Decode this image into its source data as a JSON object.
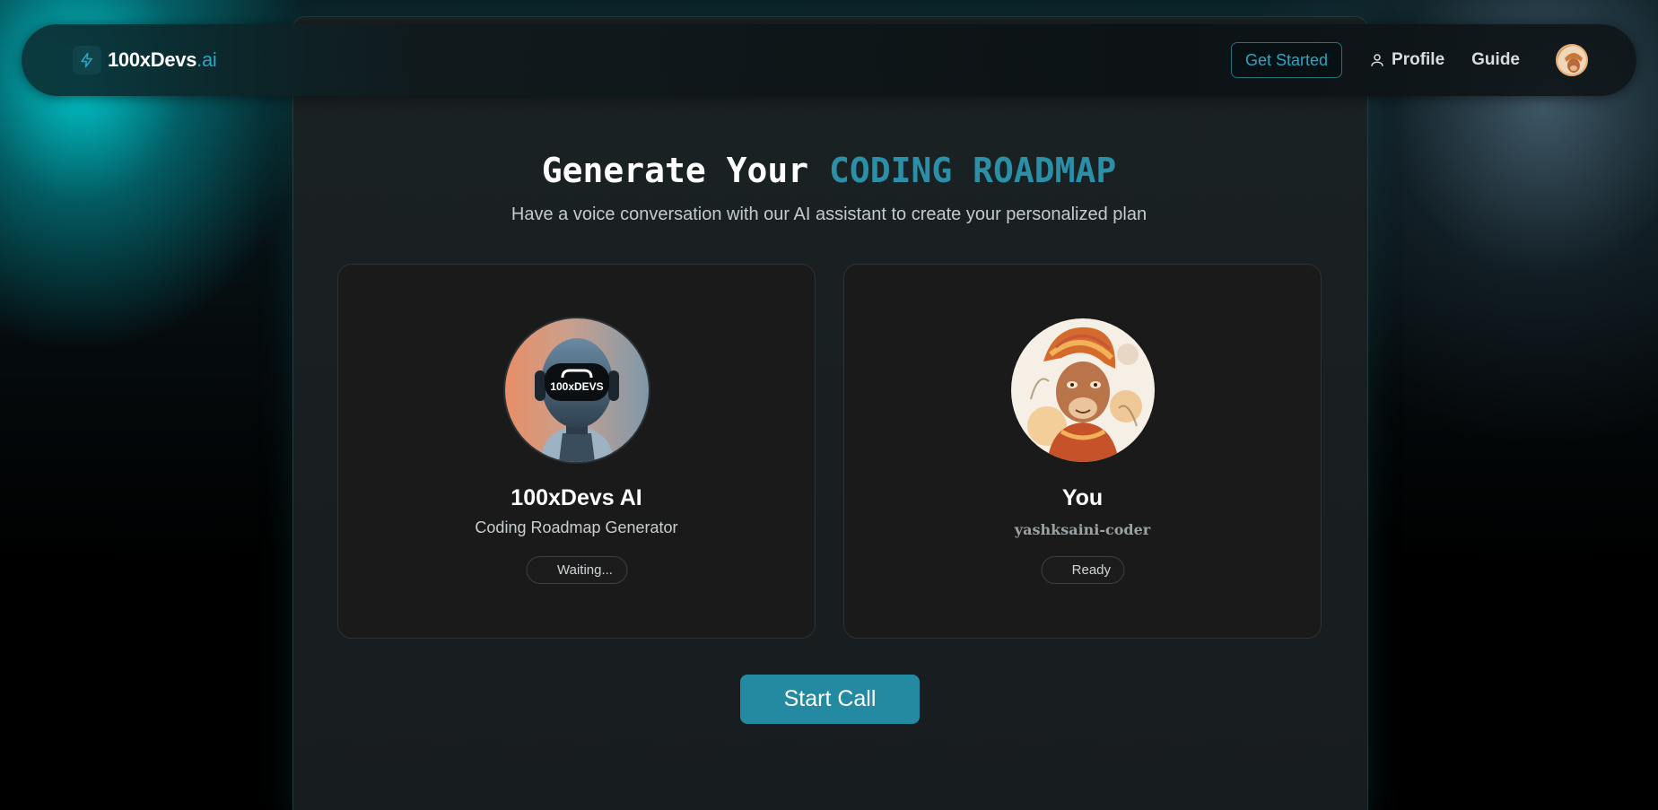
{
  "navbar": {
    "brand_main": "100xDevs",
    "brand_suffix": ".ai",
    "get_started_label": "Get Started",
    "profile_label": "Profile",
    "guide_label": "Guide"
  },
  "hero": {
    "title_prefix": "Generate Your",
    "title_highlight": "CODING ROADMAP",
    "subtitle": "Have a voice conversation with our AI assistant to create your personalized plan"
  },
  "ai_card": {
    "name": "100xDevs AI",
    "role": "Coding Roadmap Generator",
    "status": "Waiting...",
    "avatar_label": "100xDEVS"
  },
  "user_card": {
    "name": "You",
    "username": "yashksaini-coder",
    "status": "Ready"
  },
  "actions": {
    "start_call_label": "Start Call"
  },
  "colors": {
    "accent": "#2ba6c2",
    "button": "#238aa2",
    "card_bg": "#1a1a1a"
  }
}
